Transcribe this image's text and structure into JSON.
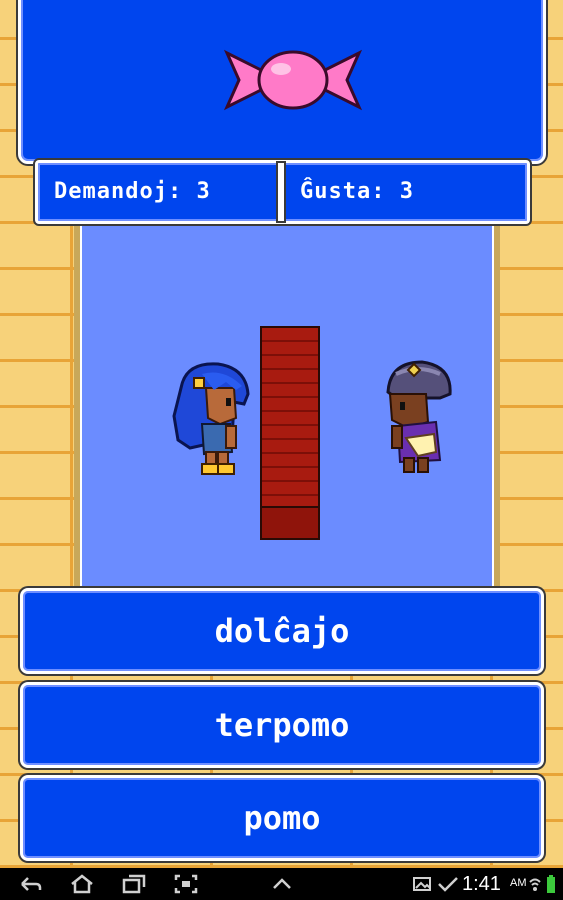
{
  "game": {
    "prompt_icon": "candy-icon",
    "prompt_color": "#ff7ac8",
    "stats": {
      "questions_label": "Demandoj: 3",
      "likes_label": "Ĝusta: 3"
    },
    "answers": [
      "dolĉajo",
      "terpomo",
      "pomo"
    ]
  },
  "status_bar": {
    "time": "1:41",
    "ampm": "AM"
  },
  "colors": {
    "panel": "#0045ee",
    "scene": "#6b8cff",
    "wall": "#f7d27a",
    "pillar": "#a81b10"
  }
}
